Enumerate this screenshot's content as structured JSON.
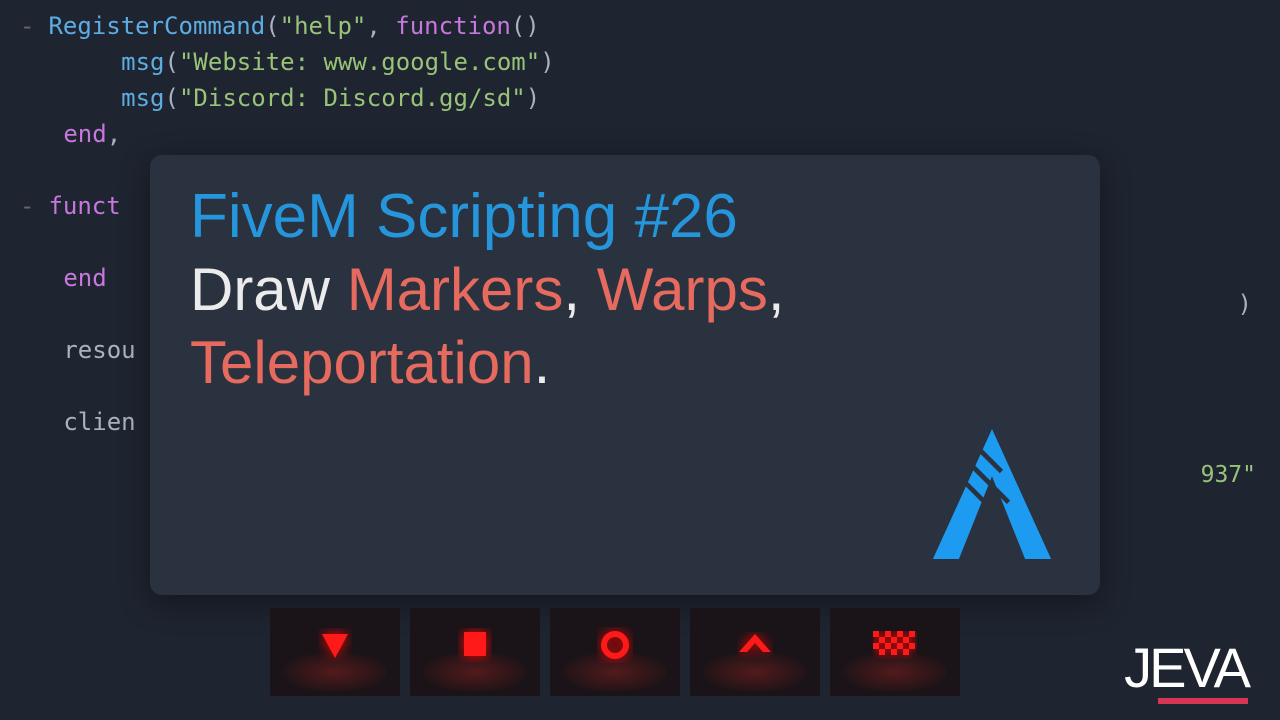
{
  "code": {
    "l1_fn": "RegisterCommand",
    "l1_open": "(",
    "l1_str": "\"help\"",
    "l1_mid": ", ",
    "l1_kw": "function",
    "l1_close": "()",
    "l2_fn": "msg",
    "l2_open": "(",
    "l2_str": "\"Website: www.google.com\"",
    "l2_close": ")",
    "l3_fn": "msg",
    "l3_open": "(",
    "l3_str": "\"Discord: Discord.gg/sd\"",
    "l3_close": ")",
    "l4_end": "end",
    "l4_comma": ",",
    "l6_kw": "funct",
    "l8_end": "end",
    "l10_plain": "resou",
    "l12_plain": "clien"
  },
  "right_frag": "937\"",
  "right_paren": ")",
  "card": {
    "title": "FiveM Scripting #26",
    "sub1_white": "Draw ",
    "sub1_red1": "Markers",
    "sub1_comma1": ", ",
    "sub1_red2": "Warps",
    "sub1_comma2": ",",
    "sub2_red": "Teleportation",
    "sub2_dot": "."
  },
  "thumbs": [
    {
      "shape": "triangle-down"
    },
    {
      "shape": "square"
    },
    {
      "shape": "ring"
    },
    {
      "shape": "chevron-up"
    },
    {
      "shape": "checker"
    }
  ],
  "brand": "JEVA"
}
